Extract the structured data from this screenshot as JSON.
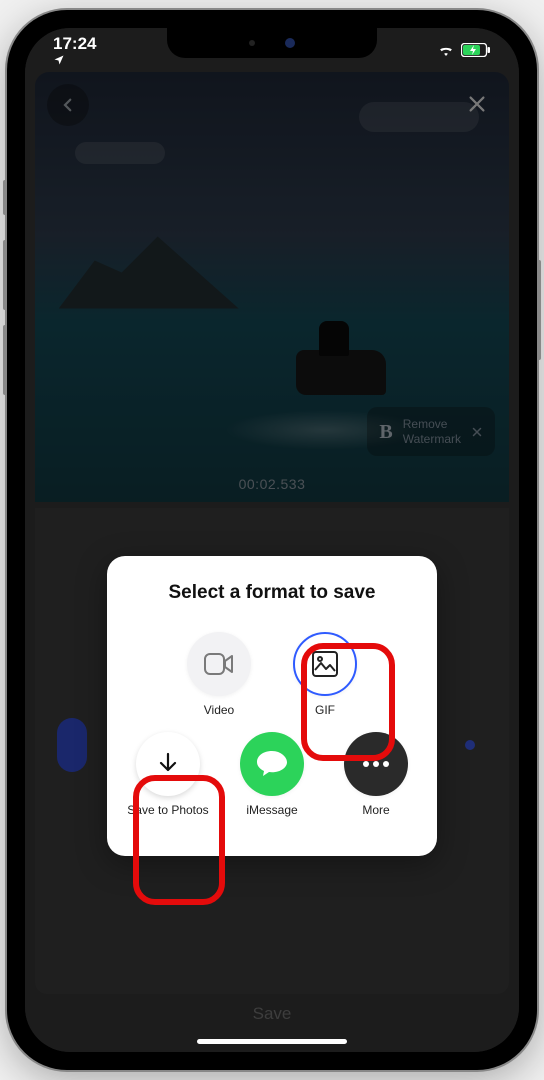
{
  "status": {
    "time": "17:24",
    "location_arrow": "↑",
    "wifi": "wifi-icon",
    "battery_charging": true
  },
  "video": {
    "timestamp": "00:02.533",
    "watermark": {
      "brand_letter": "B",
      "line1": "Remove",
      "line2": "Watermark"
    }
  },
  "bottom": {
    "save_label": "Save"
  },
  "modal": {
    "title": "Select a format to save",
    "row1": [
      {
        "id": "video",
        "label": "Video"
      },
      {
        "id": "gif",
        "label": "GIF"
      }
    ],
    "row2": [
      {
        "id": "save_photos",
        "label": "Save to Photos"
      },
      {
        "id": "imessage",
        "label": "iMessage"
      },
      {
        "id": "more",
        "label": "More"
      }
    ]
  },
  "highlights": {
    "gif": true,
    "save_to_photos": true
  }
}
